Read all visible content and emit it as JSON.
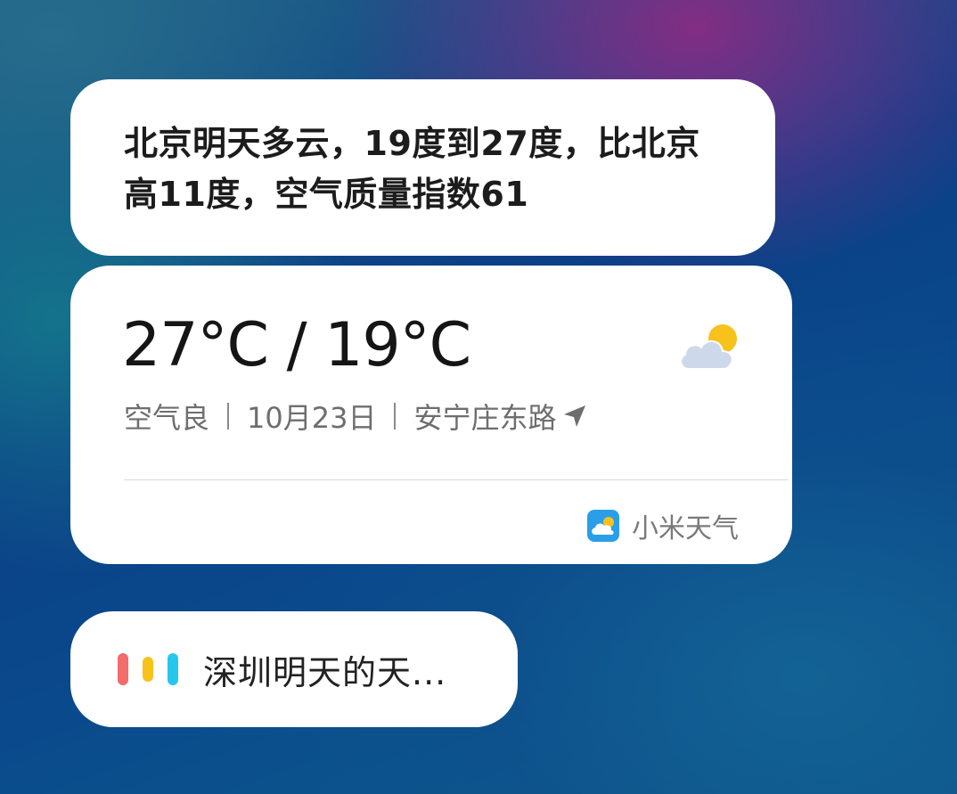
{
  "speech": {
    "line1": "北京明天多云，19度到27度，比北京",
    "line2": "高11度，空气质量指数61"
  },
  "weather": {
    "temperature": "27°C / 19°C",
    "air_quality": "空气良",
    "date": "10月23日",
    "location": "安宁庄东路",
    "source_name": "小米天气",
    "condition_icon": "partly-cloudy-icon",
    "location_icon": "navigation-arrow-icon",
    "app_icon": "xiaomi-weather-app-icon"
  },
  "query": {
    "text": "深圳明天的天...",
    "indicator_icon": "voice-assistant-bars-icon",
    "bar_colors": [
      "#f46b6b",
      "#f7c21c",
      "#27c7ec"
    ]
  },
  "colors": {
    "card_background": "#ffffff",
    "primary_text": "#1c1c1c",
    "secondary_text": "#6e6e6e",
    "app_icon_blue": "#2a9ee8",
    "sun_yellow": "#f7c21c",
    "cloud_gray": "#cdd9ea"
  }
}
